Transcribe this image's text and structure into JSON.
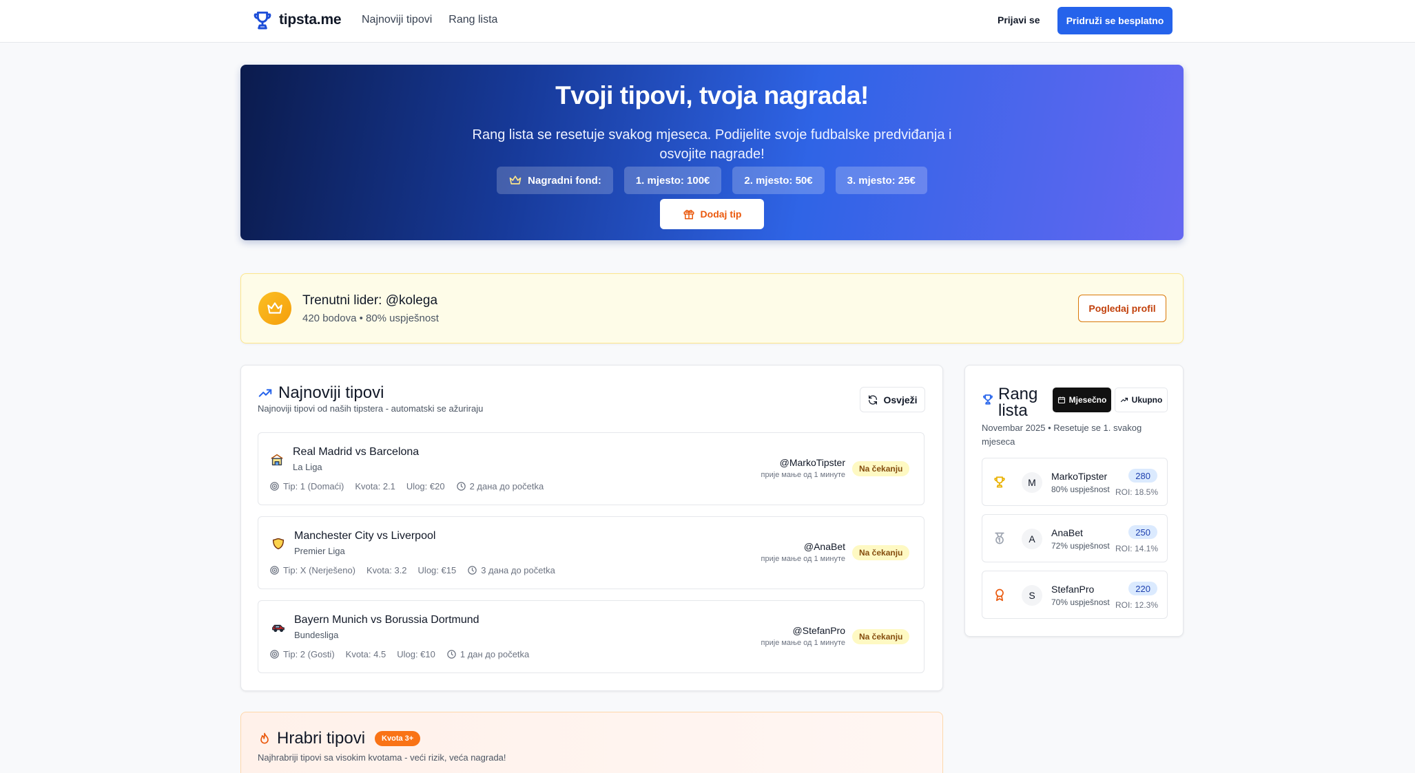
{
  "colors": {
    "primary": "#2563eb",
    "accent_orange": "#ea580c",
    "leader_bg": "#fefce8",
    "pending_bg": "#fef9c3",
    "points_bg": "#dbeafe"
  },
  "header": {
    "logo_text": "tipsta.me",
    "logo_icon": "trophy-icon",
    "nav": [
      "Najnoviji tipovi",
      "Rang lista"
    ],
    "login": "Prijavi se",
    "join": "Pridruži se besplatno"
  },
  "hero": {
    "title": "Tvoji tipovi, tvoja nagrada!",
    "subtitle": "Rang lista se resetuje svakog mjeseca. Podijelite svoje fudbalske predviđanja i osvojite nagrade!",
    "prize_fund": "Nagradni fond:",
    "prizes": [
      "1. mjesto: 100€",
      "2. mjesto: 50€",
      "3. mjesto: 25€"
    ],
    "add_tip": "Dodaj tip"
  },
  "leader": {
    "title": "Trenutni lider: @kolega",
    "stats": "420 bodova • 80% uspješnost",
    "profile_button": "Pogledaj profil"
  },
  "tips": {
    "title": "Najnoviji tipovi",
    "subtitle": "Najnoviji tipovi od naših tipstera - automatski se ažuriraju",
    "refresh": "Osvježi",
    "items": [
      {
        "icon": "stadium-icon",
        "match": "Real Madrid vs Barcelona",
        "league": "La Liga",
        "tip": "Tip: 1 (Domaći)",
        "odds": "Kvota: 2.1",
        "stake": "Ulog: €20",
        "start": "2 дана до početka",
        "user": "@MarkoTipster",
        "time": "прије мање од 1 минуте",
        "status": "Na čekanju"
      },
      {
        "icon": "shield-crest-icon",
        "match": "Manchester City vs Liverpool",
        "league": "Premier Liga",
        "tip": "Tip: X (Nerješeno)",
        "odds": "Kvota: 3.2",
        "stake": "Ulog: €15",
        "start": "3 дана до početka",
        "user": "@AnaBet",
        "time": "прије мање од 1 минуте",
        "status": "Na čekanju"
      },
      {
        "icon": "car-icon",
        "match": "Bayern Munich vs Borussia Dortmund",
        "league": "Bundesliga",
        "tip": "Tip: 2 (Gosti)",
        "odds": "Kvota: 4.5",
        "stake": "Ulog: €10",
        "start": "1 дан до početka",
        "user": "@StefanPro",
        "time": "прије мање од 1 минуте",
        "status": "Na čekanju"
      }
    ]
  },
  "ranking": {
    "title": "Rang lista",
    "monthly": "Mjesečno",
    "total": "Ukupno",
    "subtitle": "Novembar 2025 • Resetuje se 1. svakog mjeseca",
    "rows": [
      {
        "medal": "trophy-icon",
        "initial": "M",
        "name": "MarkoTipster",
        "rate": "80% uspješnost",
        "points": "280",
        "roi": "ROI: 18.5%"
      },
      {
        "medal": "medal-icon",
        "initial": "A",
        "name": "AnaBet",
        "rate": "72% uspješnost",
        "points": "250",
        "roi": "ROI: 14.1%"
      },
      {
        "medal": "award-icon",
        "initial": "S",
        "name": "StefanPro",
        "rate": "70% uspješnost",
        "points": "220",
        "roi": "ROI: 12.3%"
      }
    ]
  },
  "bold_tips": {
    "title": "Hrabri tipovi",
    "badge": "Kvota 3+",
    "subtitle": "Najhrabriji tipovi sa visokim kvotama - veći rizik, veća nagrada!"
  }
}
